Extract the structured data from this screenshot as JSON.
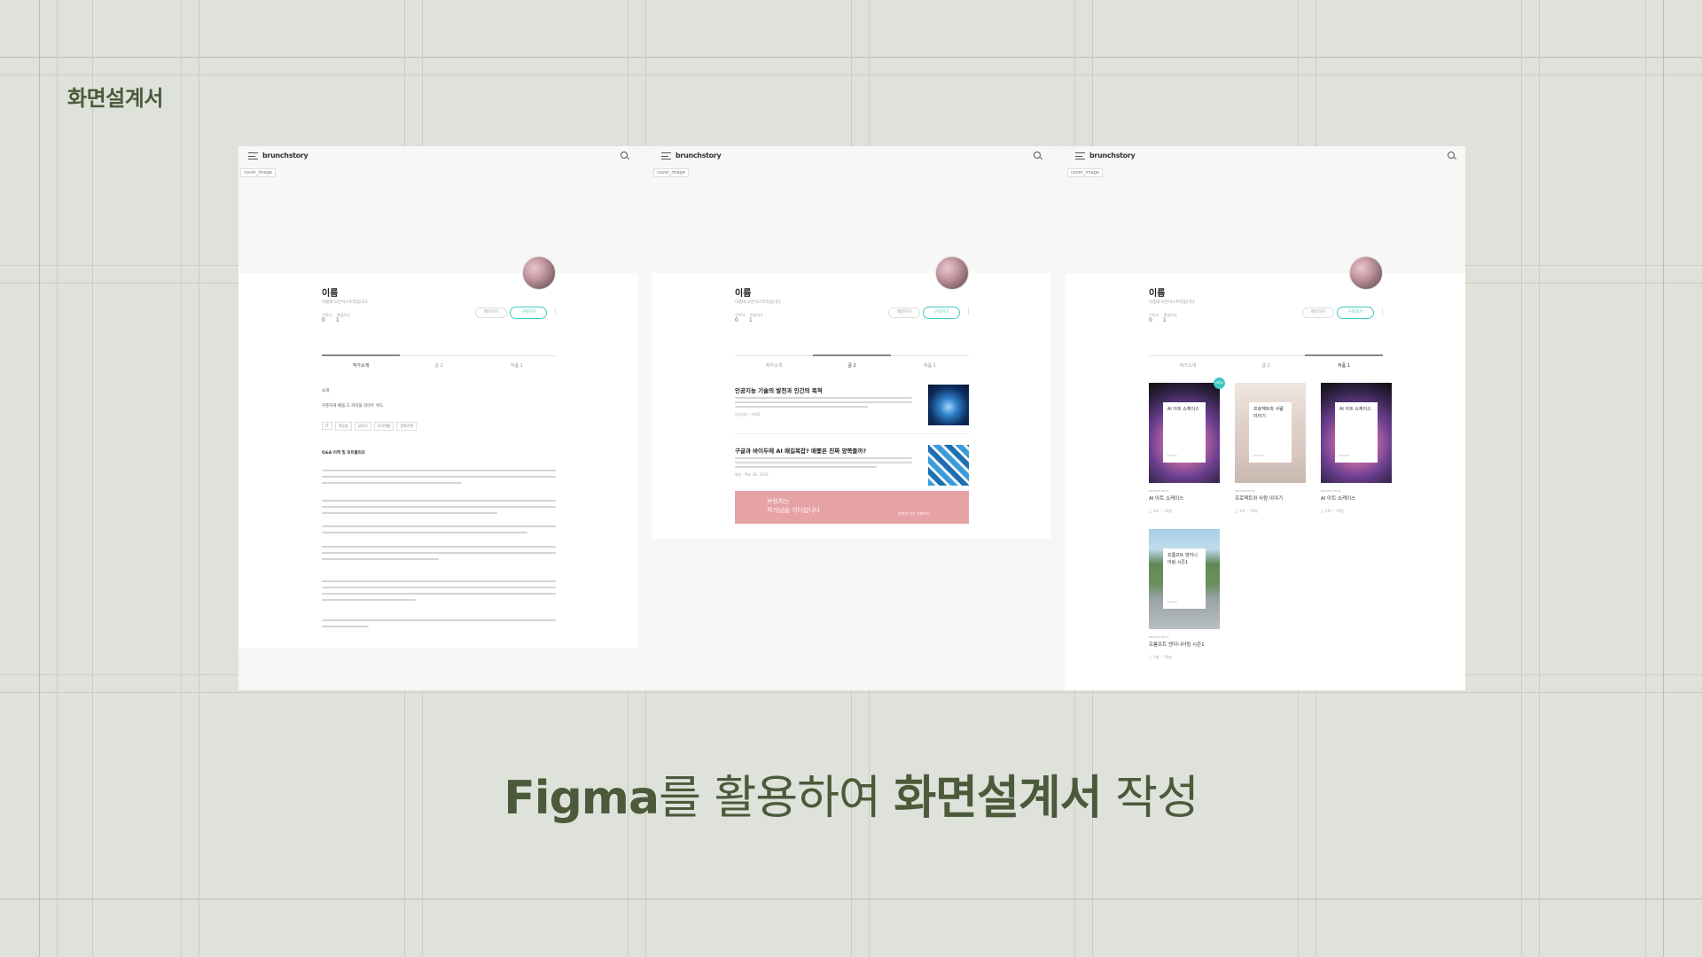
{
  "slide_title": "화면설계서",
  "caption": {
    "part1": "Figma",
    "part2": "를 활용하여 ",
    "part3": "화면설계서",
    "part4": " 작성"
  },
  "app": {
    "logo": "brunchstory",
    "cover_tag": "cover_image",
    "profile": {
      "name": "이름",
      "desc": "이름에 모든이스트리입니다.",
      "stat_labels": [
        "구독자",
        "관심작가"
      ],
      "stat_values": [
        "0",
        "1"
      ],
      "suggest_label": "제안하기",
      "follow_label": "구독하기"
    },
    "tabs": [
      "작가소개",
      "글 2",
      "작품 1"
    ]
  },
  "screen1": {
    "intro_heading": "소개",
    "intro_text": "꾸준하게 배움 도 커리을 작아두 위도.",
    "keywords": [
      "IT",
      "학습법",
      "글쓰기",
      "자기계발",
      "문화기획"
    ],
    "career_heading": "Q&A 이력 및 포트폴리오"
  },
  "screen2": {
    "articles": [
      {
        "title": "인공지능 기술의 발전과 인간의 목적",
        "meta": "인공지능 · 조회2",
        "thumb": "globe"
      },
      {
        "title": "구글과 바이두에 AI 매길복잡? 매쫓은 진짜 양쪽들까?",
        "meta": "매일 · Mar 06. 2024",
        "thumb": "tech"
      }
    ],
    "banner_title_l1": "브런치는",
    "banner_title_l2": "작가님을 기다립니다",
    "banner_sub": "브런치 작가 신청하기"
  },
  "screen3": {
    "new_badge": "NEW",
    "works": [
      {
        "card": "AI 아트 쇼케이스",
        "label": "BRUNCH BOOK",
        "title": "AI 아트 쇼케이스",
        "meta": "□ 1화  ♡ 50분",
        "style": "space"
      },
      {
        "card": "프로젝트와 사람 이야기",
        "label": "BRUNCH BOOK",
        "title": "프로젝트와 사람 이야기",
        "meta": "□ 1화  ♡ 50분",
        "style": "photo"
      },
      {
        "card": "AI 아트 쇼케이스",
        "label": "BRUNCH BOOK",
        "title": "AI 아트 쇼케이스",
        "meta": "□ 1화  ♡ 50분",
        "style": "space"
      },
      {
        "card": "프롬프트 엔지니어링 시즌1",
        "label": "BRUNCH BOOK",
        "title": "프롬프트 엔지니어링 시즌1",
        "meta": "□ 1화  ♡ 50분",
        "style": "road"
      }
    ]
  },
  "colors": {
    "background": "#dfe2da",
    "heading_green": "#4b5a3a",
    "accent_mint": "#40c9c4",
    "banner_pink": "#e6a2a5"
  }
}
